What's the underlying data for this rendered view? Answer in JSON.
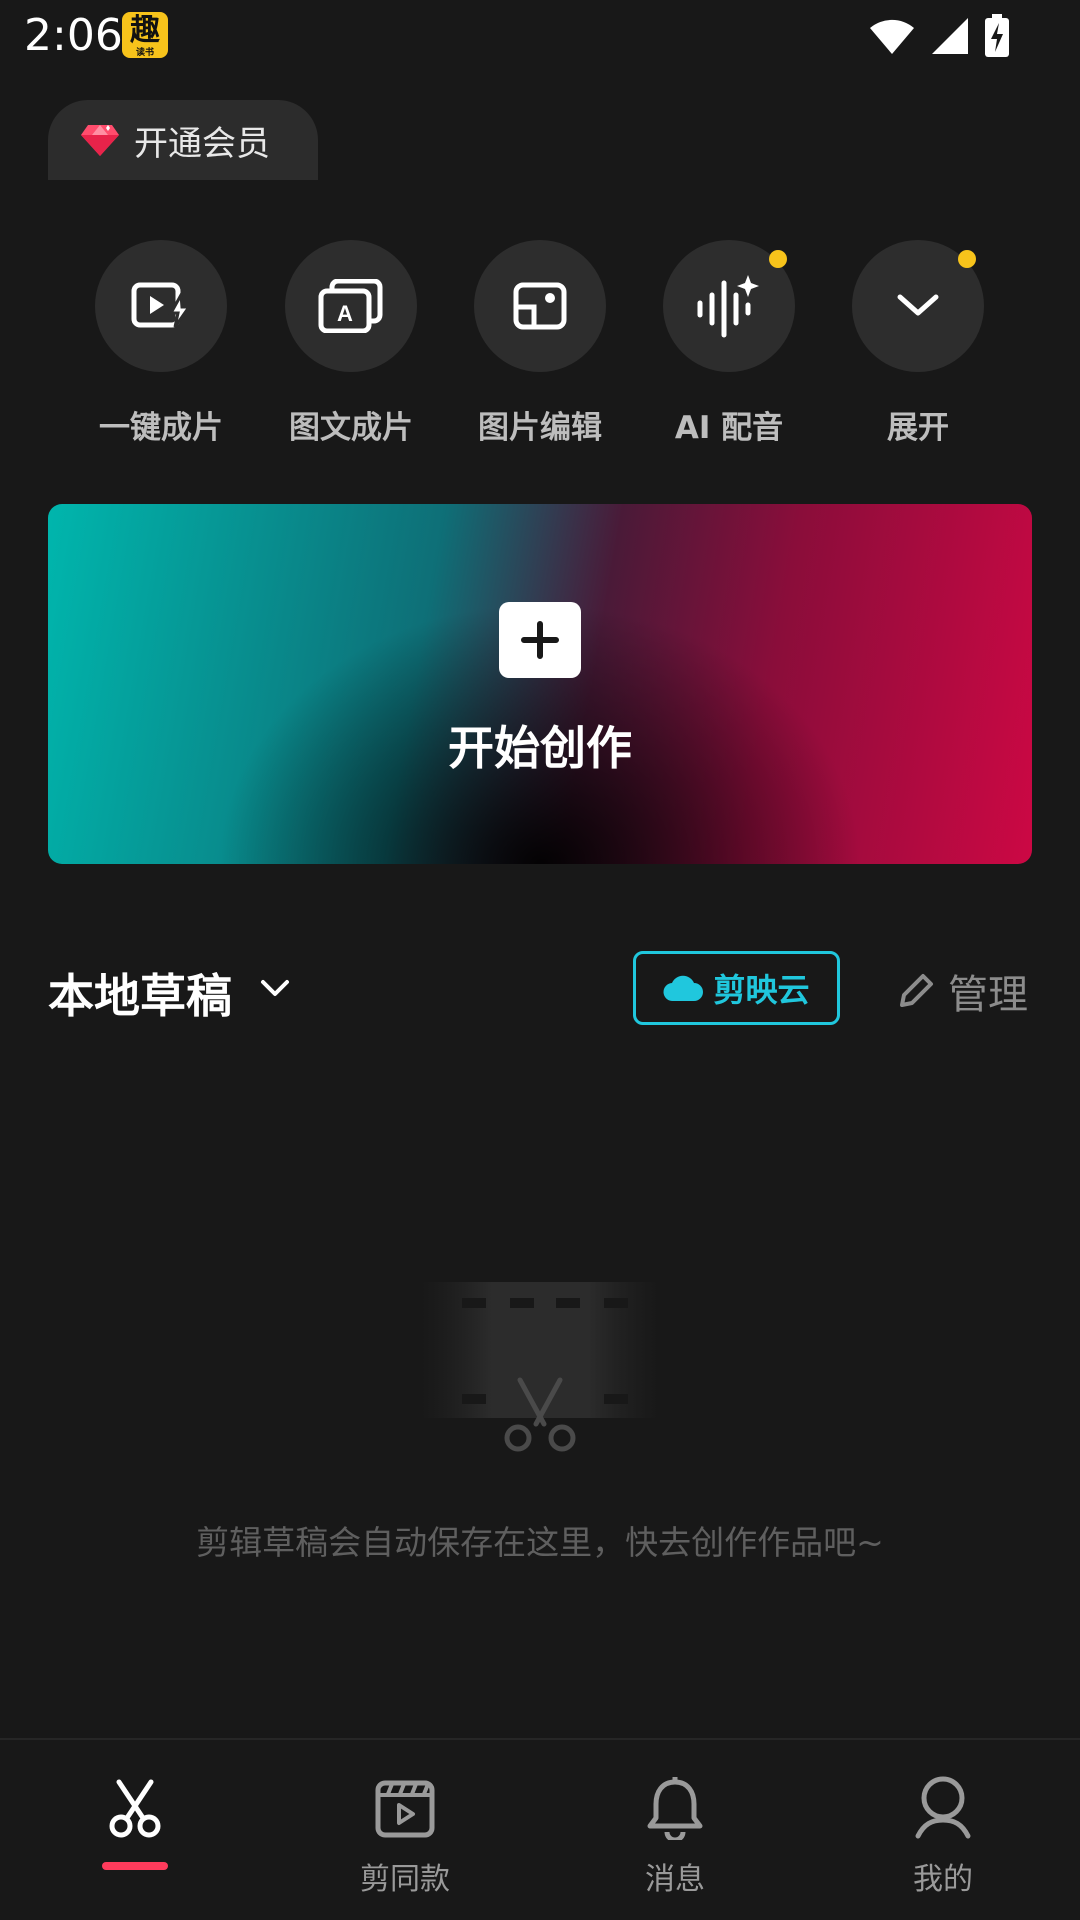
{
  "status_bar": {
    "time": "2:06",
    "app_badge_icon": "qutoutiao-app-icon",
    "app_badge_char": "趣",
    "app_badge_subtext": "读书"
  },
  "vip": {
    "label": "开通会员",
    "icon": "diamond-icon"
  },
  "tools": [
    {
      "label": "一键成片",
      "icon": "video-flash-icon",
      "dot": false
    },
    {
      "label": "图文成片",
      "icon": "text-to-video-icon",
      "dot": false
    },
    {
      "label": "图片编辑",
      "icon": "image-edit-icon",
      "dot": false
    },
    {
      "label": "AI 配音",
      "icon": "ai-voice-icon",
      "dot": true
    },
    {
      "label": "展开",
      "icon": "chevron-down-icon",
      "dot": true
    }
  ],
  "hero": {
    "title": "开始创作",
    "icon": "plus-icon"
  },
  "drafts": {
    "title": "本地草稿",
    "cloud_label": "剪映云",
    "manage_label": "管理",
    "empty_text": "剪辑草稿会自动保存在这里，快去创作作品吧~"
  },
  "bottom_nav": [
    {
      "label": "",
      "icon": "scissors-icon",
      "active": true
    },
    {
      "label": "剪同款",
      "icon": "template-clapper-icon",
      "active": false
    },
    {
      "label": "消息",
      "icon": "bell-icon",
      "active": false
    },
    {
      "label": "我的",
      "icon": "profile-icon",
      "active": false
    }
  ],
  "colors": {
    "background": "#181818",
    "accent_cyan": "#20c7dd",
    "accent_red": "#ff3b5c",
    "notification_dot": "#f7c31b"
  }
}
